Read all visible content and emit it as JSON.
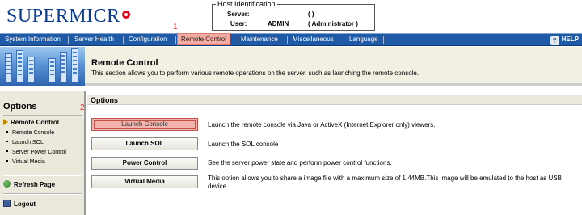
{
  "header": {
    "logo_text": "SUPERMICR",
    "host_id": {
      "legend": "Host Identification",
      "server_label": "Server:",
      "server_value": "(                    )",
      "user_label": "User:",
      "user_value": "ADMIN",
      "user_role": "(   Administrator   )"
    }
  },
  "nav": {
    "items": [
      {
        "label": "System Information"
      },
      {
        "label": "Server Health"
      },
      {
        "label": "Configuration"
      },
      {
        "label": "Remote Control"
      },
      {
        "label": "Maintenance"
      },
      {
        "label": "Miscellaneous"
      },
      {
        "label": "Language"
      }
    ],
    "help_label": "HELP",
    "marker1": "1",
    "marker2": "2"
  },
  "banner": {
    "title": "Remote Control",
    "description": "This section allows you to perform various remote operations on the server, such as launching the remote console."
  },
  "sidebar": {
    "title": "Options",
    "section_label": "Remote Control",
    "items": [
      {
        "label": "Remote Console"
      },
      {
        "label": "Launch SOL"
      },
      {
        "label": "Server Power Control"
      },
      {
        "label": "Virtual Media"
      }
    ],
    "refresh_label": "Refresh Page",
    "logout_label": "Logout"
  },
  "main": {
    "options_title": "Options",
    "actions": [
      {
        "button": "Launch Console",
        "description": "Launch the remote console via Java or ActiveX (Internet Explorer only) viewers."
      },
      {
        "button": "Launch SOL",
        "description": "Launch the SOL console"
      },
      {
        "button": "Power Control",
        "description": "See the server power state and perform power control functions."
      },
      {
        "button": "Virtual Media",
        "description": "This option allows you to share a image file with a maximum size of 1.44MB.This image will be emulated to the host as USB device."
      }
    ]
  },
  "colors": {
    "nav_bg": "#1f5aa6",
    "active_tab": "#f5aaa2",
    "logo_blue": "#0a3b8f",
    "logo_red": "#e3001b"
  }
}
